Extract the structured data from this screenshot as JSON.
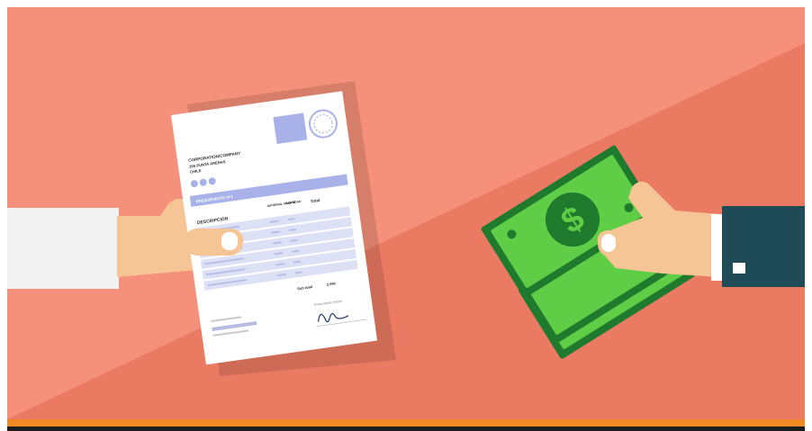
{
  "colors": {
    "background_light": "#f5907a",
    "background_dark": "#ea7a62",
    "bottom_bar": "#f08a24",
    "bottom_strip": "#1c1c1c",
    "skin": "#f6c596",
    "sleeve_left": "#f2f2f2",
    "sleeve_right": "#1f4b57",
    "document_paper": "#ffffff",
    "document_accent": "#a8b2e8",
    "document_table": "#dde1f5",
    "money_dark": "#1f7a2e",
    "money_light": "#5fce46"
  },
  "icons": [
    "dollar-sign-icon",
    "stamp-seal-icon",
    "signature-icon"
  ],
  "document": {
    "company": "CORPORATION/COMPANY",
    "address_1": "255 PUNTA ARENAS",
    "address_2": "CHILE",
    "banner": "PRESUPUESTO N°1",
    "col_desc": "DESCRIPCIÓN",
    "col_mat": "MATERIAL UNIDAD",
    "col_unit": "CANTIDAD",
    "col_total": "Total",
    "subtotal_label": "Sub total",
    "subtotal_value": "2.990",
    "sign_label": "Firma cliente y fecha"
  },
  "money": {
    "symbol": "$"
  }
}
